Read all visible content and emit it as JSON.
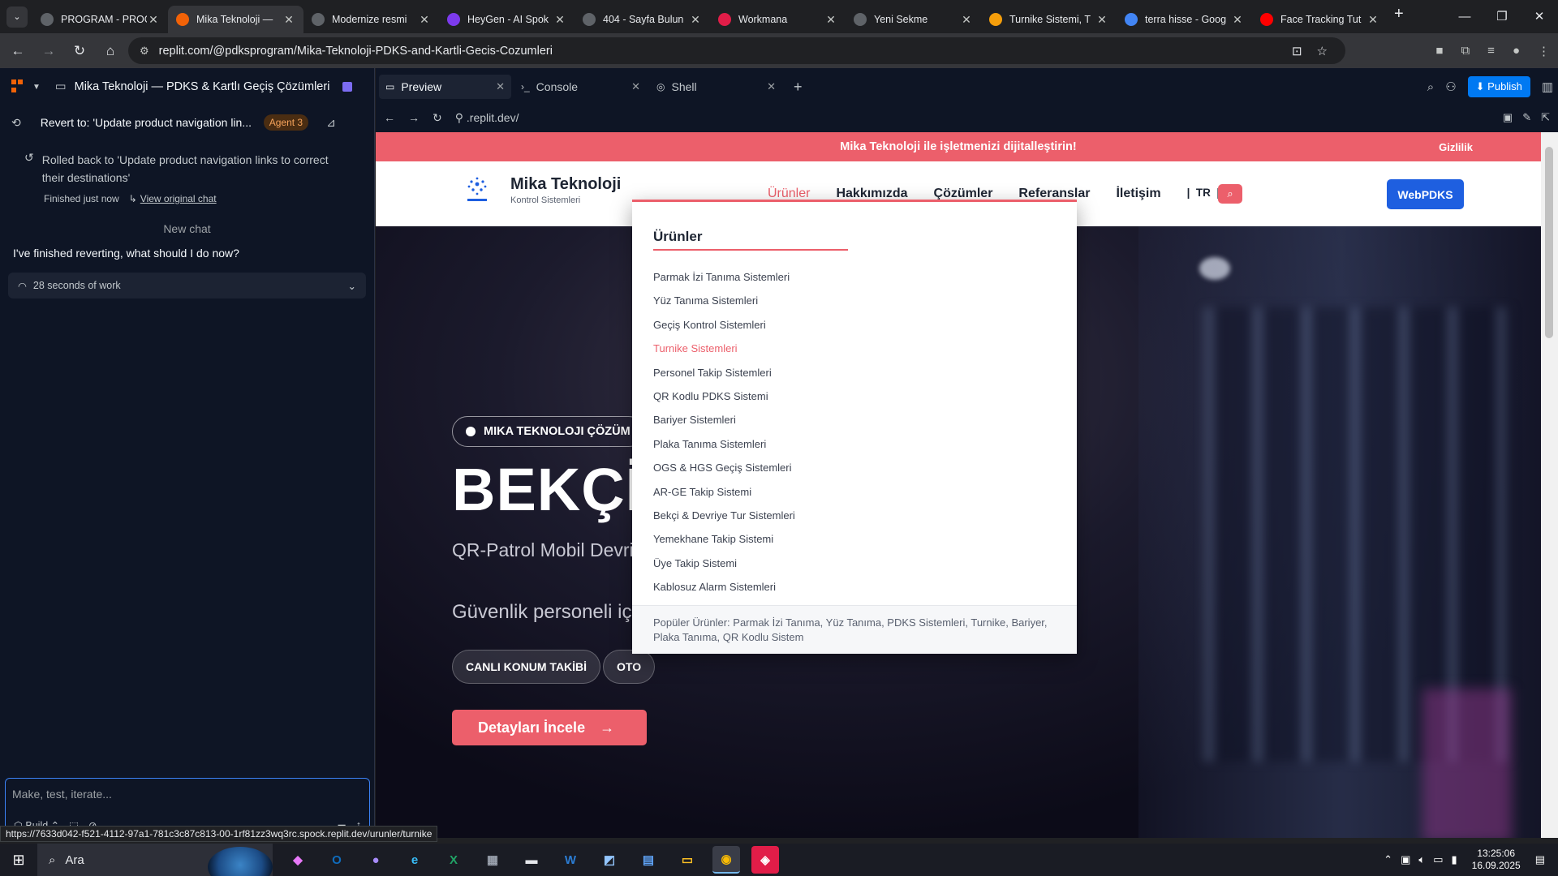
{
  "browser": {
    "tabs": [
      {
        "title": "PROGRAM - PROG",
        "icon": "globe-icon",
        "color": "#5f6368",
        "active": false
      },
      {
        "title": "Mika Teknoloji —",
        "icon": "replit-icon",
        "color": "#f26207",
        "active": true
      },
      {
        "title": "Modernize resmi",
        "icon": "openai-icon",
        "color": "#5f6368",
        "active": false
      },
      {
        "title": "HeyGen - AI Spok",
        "icon": "heygen-icon",
        "color": "#7c3aed",
        "active": false
      },
      {
        "title": "404 - Sayfa Bulun",
        "icon": "globe-icon",
        "color": "#5f6368",
        "active": false
      },
      {
        "title": "Workmana",
        "icon": "workmana-icon",
        "color": "#e11d48",
        "active": false
      },
      {
        "title": "Yeni Sekme",
        "icon": "chrome-icon",
        "color": "#5f6368",
        "active": false
      },
      {
        "title": "Turnike Sistemi, T",
        "icon": "site-icon",
        "color": "#f59e0b",
        "active": false
      },
      {
        "title": "terra hisse - Goog",
        "icon": "google-icon",
        "color": "#4285f4",
        "active": false
      },
      {
        "title": "Face Tracking Tut",
        "icon": "youtube-icon",
        "color": "#ff0000",
        "active": false
      }
    ],
    "url": "replit.com/@pdksprogram/Mika-Teknoloji-PDKS-and-Kartli-Gecis-Cozumleri",
    "status_link": "https://7633d042-f521-4112-97a1-781c3c87c813-00-1rf81zz3wq3rc.spock.replit.dev/urunler/turnike"
  },
  "replit": {
    "project_title": "Mika Teknoloji — PDKS & Kartlı Geçiş Çözümleri",
    "revert_title": "Revert to: 'Update product navigation lin...",
    "agent_badge": "Agent 3",
    "rolled_back_text": "Rolled back to 'Update product navigation links to correct their destinations'",
    "finished_text": "Finished just now",
    "view_original": "View original chat",
    "new_chat": "New chat",
    "user_message": "I've finished reverting, what should I do now?",
    "work_summary": "28 seconds of work",
    "composer_placeholder": "Make, test, iterate...",
    "build_label": "Build",
    "workspace_tabs": [
      "Preview",
      "Console",
      "Shell"
    ],
    "publish_label": "Publish",
    "preview_url": ".replit.dev/"
  },
  "site": {
    "announcement": "Mika Teknoloji ile işletmenizi dijitalleştirin!",
    "privacy": "Gizlilik",
    "brand_name": "Mika Teknoloji",
    "brand_sub": "Kontrol Sistemleri",
    "nav": [
      "Ürünler",
      "Hakkımızda",
      "Çözümler",
      "Referanslar",
      "İletişim"
    ],
    "lang": "TR",
    "webpdks": "WebPDKS",
    "hero_pill": "MIKA TEKNOLOJI ÇÖZÜM",
    "hero_title": "BEKÇİ",
    "hero_subtitle": "QR-Patrol Mobil Devriy",
    "hero_text": "Güvenlik personeli için",
    "chips": [
      "CANLI KONUM TAKİBİ",
      "OTO"
    ],
    "cta": "Detayları İncele",
    "dropdown": {
      "title": "Ürünler",
      "items": [
        "Parmak İzi Tanıma Sistemleri",
        "Yüz Tanıma Sistemleri",
        "Geçiş Kontrol Sistemleri",
        "Turnike Sistemleri",
        "Personel Takip Sistemleri",
        "QR Kodlu PDKS Sistemi",
        "Bariyer Sistemleri",
        "Plaka Tanıma Sistemleri",
        "OGS & HGS Geçiş Sistemleri",
        "AR-GE Takip Sistemi",
        "Bekçi & Devriye Tur Sistemleri",
        "Yemekhane Takip Sistemi",
        "Üye Takip Sistemi",
        "Kablosuz Alarm Sistemleri"
      ],
      "highlighted_index": 3,
      "footer": "Popüler Ürünler: Parmak İzi Tanıma, Yüz Tanıma, PDKS Sistemleri, Turnike, Bariyer, Plaka Tanıma, QR Kodlu Sistem"
    }
  },
  "taskbar": {
    "search_label": "Ara",
    "time": "13:25:06",
    "date": "16.09.2025"
  },
  "colors": {
    "accent": "#ec5f6b",
    "webpdks": "#1e5fe0",
    "replit_bg": "#0e1525",
    "publish": "#0079f2"
  }
}
